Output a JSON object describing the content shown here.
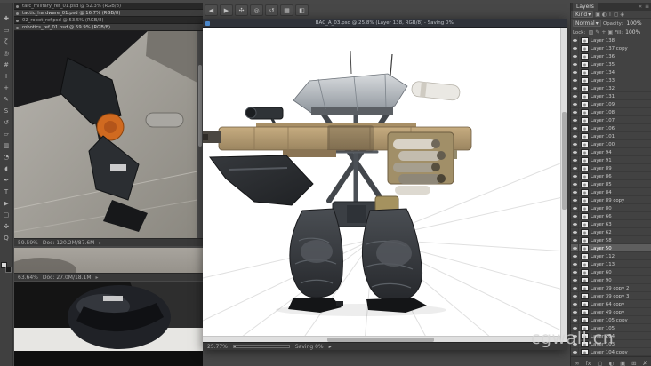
{
  "toolbar": {
    "tools": [
      {
        "name": "move-tool",
        "glyph": "✚"
      },
      {
        "name": "marquee-tool",
        "glyph": "▭"
      },
      {
        "name": "lasso-tool",
        "glyph": "ζ"
      },
      {
        "name": "quick-selection-tool",
        "glyph": "◎"
      },
      {
        "name": "crop-tool",
        "glyph": "#"
      },
      {
        "name": "eyedropper-tool",
        "glyph": "I"
      },
      {
        "name": "healing-brush-tool",
        "glyph": "+"
      },
      {
        "name": "brush-tool",
        "glyph": "✎"
      },
      {
        "name": "clone-stamp-tool",
        "glyph": "S"
      },
      {
        "name": "history-brush-tool",
        "glyph": "↺"
      },
      {
        "name": "eraser-tool",
        "glyph": "▱"
      },
      {
        "name": "gradient-tool",
        "glyph": "▥"
      },
      {
        "name": "blur-tool",
        "glyph": "◔"
      },
      {
        "name": "dodge-tool",
        "glyph": "◖"
      },
      {
        "name": "pen-tool",
        "glyph": "✒"
      },
      {
        "name": "type-tool",
        "glyph": "T"
      },
      {
        "name": "path-selection-tool",
        "glyph": "▶"
      },
      {
        "name": "shape-tool",
        "glyph": "▢"
      },
      {
        "name": "hand-tool",
        "glyph": "✣"
      },
      {
        "name": "zoom-tool",
        "glyph": "Q"
      }
    ]
  },
  "ref_windows": {
    "titlebars": [
      {
        "title": "tarc_military_ref_01.psd @ 52.3% (RGB/8)",
        "state": "dark"
      },
      {
        "title": "tactic_hardware_01.psd @ 16.7% (RGB/8)",
        "state": "mid"
      },
      {
        "title": "02_robot_ref.psd @ 53.5% (RGB/8)",
        "state": "dark"
      },
      {
        "title": "robotics_ref_01.psd @ 59.9% (RGB/8)",
        "state": "mid"
      }
    ],
    "window1": {
      "zoom": "59.59%",
      "doc": "Doc: 120.2M/87.6M"
    },
    "window2": {
      "zoom": "63.64%",
      "doc": "Doc: 27.0M/18.1M"
    }
  },
  "options_bar": {
    "buttons": [
      {
        "name": "nav-back-button",
        "glyph": "◀"
      },
      {
        "name": "nav-forward-button",
        "glyph": "▶"
      },
      {
        "name": "hand-button",
        "glyph": "✣"
      },
      {
        "name": "zoom-button",
        "glyph": "◎"
      },
      {
        "name": "rotate-view-button",
        "glyph": "↺"
      },
      {
        "name": "arrange-documents-button",
        "glyph": "▦"
      },
      {
        "name": "screen-mode-button",
        "glyph": "◧"
      }
    ]
  },
  "main_window": {
    "title": "BAC_A_03.psd @ 25.8% (Layer 138, RGB/8) - Saving 0%",
    "status": {
      "zoom": "25.77%",
      "saving": "Saving 0%",
      "menu_arrow": "▸"
    }
  },
  "layers_panel": {
    "tab": "Layers",
    "collapse_icon": "«",
    "menu_icon": "≡",
    "filter_label": "Kind",
    "filter_arrow": "▾",
    "filter_icons": [
      {
        "name": "filter-pixel-layers-icon",
        "glyph": "▣"
      },
      {
        "name": "filter-adjustment-layers-icon",
        "glyph": "◐"
      },
      {
        "name": "filter-type-layers-icon",
        "glyph": "T"
      },
      {
        "name": "filter-shape-layers-icon",
        "glyph": "▢"
      },
      {
        "name": "filter-smart-objects-icon",
        "glyph": "◈"
      }
    ],
    "blend_mode": "Normal",
    "dropdown_arrow": "▾",
    "opacity_label": "Opacity:",
    "opacity_value": "100%",
    "lock_label": "Lock:",
    "lock_icons": [
      {
        "name": "lock-transparency-icon",
        "glyph": "▨"
      },
      {
        "name": "lock-pixels-icon",
        "glyph": "✎"
      },
      {
        "name": "lock-position-icon",
        "glyph": "+"
      },
      {
        "name": "lock-all-icon",
        "glyph": "▣"
      }
    ],
    "fill_label": "Fill:",
    "fill_value": "100%",
    "selected_index": 26,
    "layers": [
      {
        "name": "Layer 138"
      },
      {
        "name": "Layer 137 copy"
      },
      {
        "name": "Layer 136"
      },
      {
        "name": "Layer 135"
      },
      {
        "name": "Layer 134"
      },
      {
        "name": "Layer 133"
      },
      {
        "name": "Layer 132"
      },
      {
        "name": "Layer 131"
      },
      {
        "name": "Layer 109"
      },
      {
        "name": "Layer 108"
      },
      {
        "name": "Layer 107"
      },
      {
        "name": "Layer 106"
      },
      {
        "name": "Layer 101"
      },
      {
        "name": "Layer 100"
      },
      {
        "name": "Layer 94"
      },
      {
        "name": "Layer 91"
      },
      {
        "name": "Layer 89"
      },
      {
        "name": "Layer 86"
      },
      {
        "name": "Layer 85"
      },
      {
        "name": "Layer 84"
      },
      {
        "name": "Layer 89 copy"
      },
      {
        "name": "Layer 80"
      },
      {
        "name": "Layer 66"
      },
      {
        "name": "Layer 63"
      },
      {
        "name": "Layer 62"
      },
      {
        "name": "Layer 58"
      },
      {
        "name": "Layer 50"
      },
      {
        "name": "Layer 112"
      },
      {
        "name": "Layer 113"
      },
      {
        "name": "Layer 60"
      },
      {
        "name": "Layer 90"
      },
      {
        "name": "Layer 39 copy 2"
      },
      {
        "name": "Layer 39 copy 3"
      },
      {
        "name": "Layer 64 copy"
      },
      {
        "name": "Layer 49 copy"
      },
      {
        "name": "Layer 105 copy"
      },
      {
        "name": "Layer 105"
      },
      {
        "name": "Layer 104"
      },
      {
        "name": "Layer 103"
      },
      {
        "name": "Layer 104 copy"
      }
    ],
    "bottom_icons": [
      {
        "name": "link-layers-icon",
        "glyph": "∞"
      },
      {
        "name": "layer-effects-icon",
        "glyph": "fx"
      },
      {
        "name": "layer-mask-icon",
        "glyph": "▢"
      },
      {
        "name": "adjustment-layer-icon",
        "glyph": "◐"
      },
      {
        "name": "layer-group-icon",
        "glyph": "▣"
      },
      {
        "name": "new-layer-icon",
        "glyph": "⊞"
      },
      {
        "name": "delete-layer-icon",
        "glyph": "✗"
      }
    ]
  },
  "watermark": "cgwall.cn"
}
